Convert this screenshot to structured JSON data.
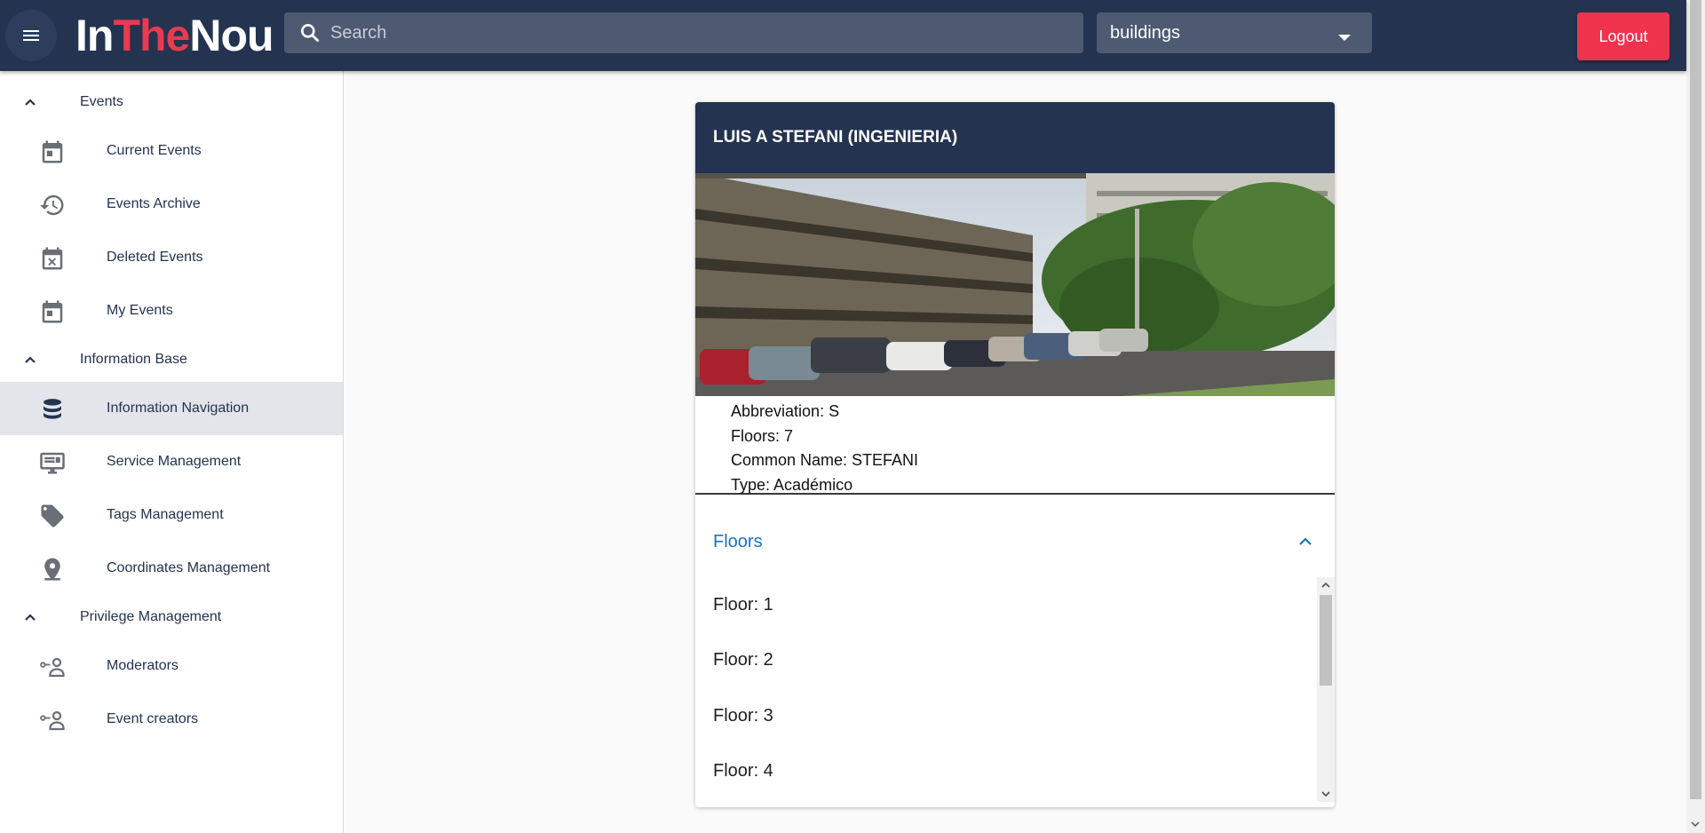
{
  "app": {
    "logo_part1": "In",
    "logo_part2": "The",
    "logo_part3": "Nou",
    "brand_color": "#243350",
    "accent_color": "#e83a50"
  },
  "header": {
    "search_placeholder": "Search",
    "search_icon": "search-icon",
    "category_select_value": "buildings",
    "logout_label": "Logout",
    "menu_icon": "hamburger-menu-icon"
  },
  "sidebar": {
    "events_section": "Events",
    "current_events": "Current Events",
    "events_archive": "Events Archive",
    "deleted_events": "Deleted Events",
    "my_events": "My Events",
    "information_section": "Information Base",
    "information_navigation": "Information Navigation",
    "service_management": "Service Management",
    "tags_management": "Tags Management",
    "coordinates_management": "Coordinates Management",
    "privilege_section": "Privilege Management",
    "moderators": "Moderators",
    "event_creators": "Event creators"
  },
  "building": {
    "title": "LUIS A STEFANI (INGENIERIA)",
    "abbreviation": "Abbreviation: S",
    "floors": "Floors: 7",
    "common_name": "Common Name: STEFANI",
    "type": "Type: Académico"
  },
  "floors_panel": {
    "title": "Floors",
    "items": [
      "Floor: 1",
      "Floor: 2",
      "Floor: 3",
      "Floor: 4"
    ]
  }
}
